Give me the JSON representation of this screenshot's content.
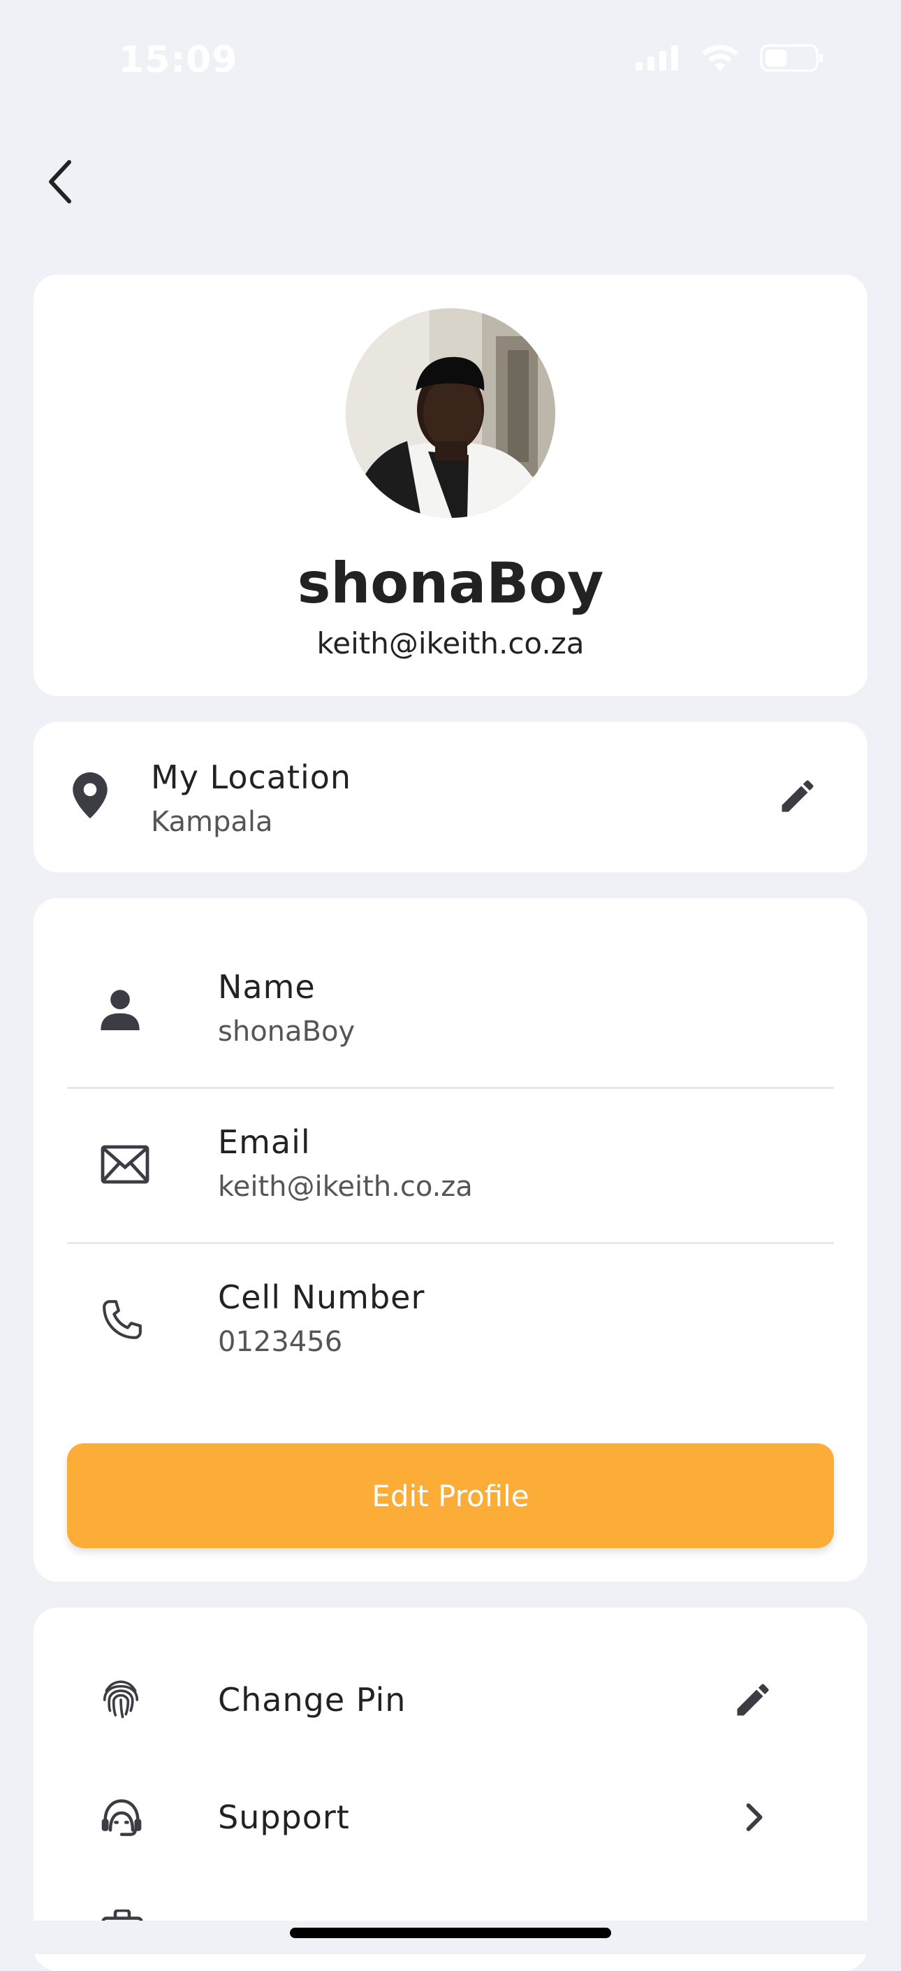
{
  "status_bar": {
    "time": "15:09"
  },
  "icons": {
    "back": "chevron-left-icon",
    "location": "location-pin-icon",
    "edit": "pencil-icon",
    "person": "person-icon",
    "email": "envelope-icon",
    "phone": "phone-icon",
    "pin": "fingerprint-icon",
    "support": "headset-icon",
    "chevron": "chevron-right-icon"
  },
  "profile": {
    "username": "shonaBoy",
    "email": "keith@ikeith.co.za"
  },
  "location": {
    "title": "My Location",
    "value": "Kampala"
  },
  "info": {
    "name_label": "Name",
    "name_value": "shonaBoy",
    "email_label": "Email",
    "email_value": "keith@ikeith.co.za",
    "cell_label": "Cell Number",
    "cell_value": "0123456",
    "edit_button": "Edit Profile"
  },
  "settings": {
    "items": [
      {
        "label": "Change Pin"
      },
      {
        "label": "Support"
      }
    ]
  },
  "colors": {
    "background": "#eff1f6",
    "card": "#ffffff",
    "accent": "#fbad37",
    "icon": "#3c3c44"
  }
}
